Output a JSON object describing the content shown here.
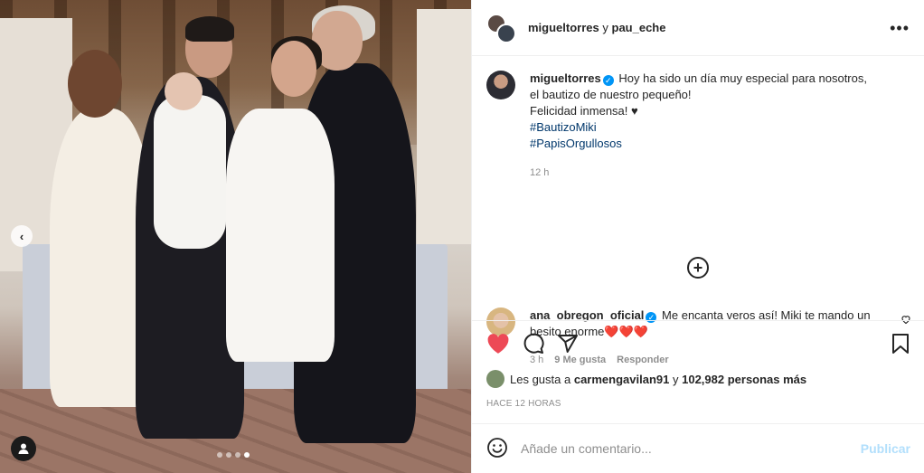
{
  "post": {
    "header_user1": "migueltorres",
    "header_connector": "y",
    "header_user2": "pau_eche"
  },
  "caption": {
    "username": "migueltorres",
    "text_line1": "Hoy ha sido un día muy especial para nosotros,",
    "text_line2": "el bautizo de nuestro pequeño!",
    "text_line3": "Felicidad inmensa! ♥",
    "hashtag1": "#BautizoMiki",
    "hashtag2": "#PapisOrgullosos",
    "time": "12 h"
  },
  "comment": {
    "username": "ana_obregon_oficial",
    "text": "Me encanta veros así! Miki te mando un besito enorme❤️❤️❤️",
    "time": "3 h",
    "likes": "9 Me gusta",
    "reply": "Responder"
  },
  "likes": {
    "prefix": "Les gusta a",
    "user": "carmengavilan91",
    "connector": "y",
    "count": "102,982 personas más"
  },
  "time_ago": "HACE 12 HORAS",
  "add_comment": {
    "placeholder": "Añade un comentario...",
    "publish": "Publicar"
  },
  "carousel": {
    "total_slides": 4,
    "active_slide": 4
  },
  "colors": {
    "like_red": "#ed4956",
    "link_blue": "#00376b",
    "verified_blue": "#0095f6",
    "publish_disabled": "#b2dffc"
  }
}
